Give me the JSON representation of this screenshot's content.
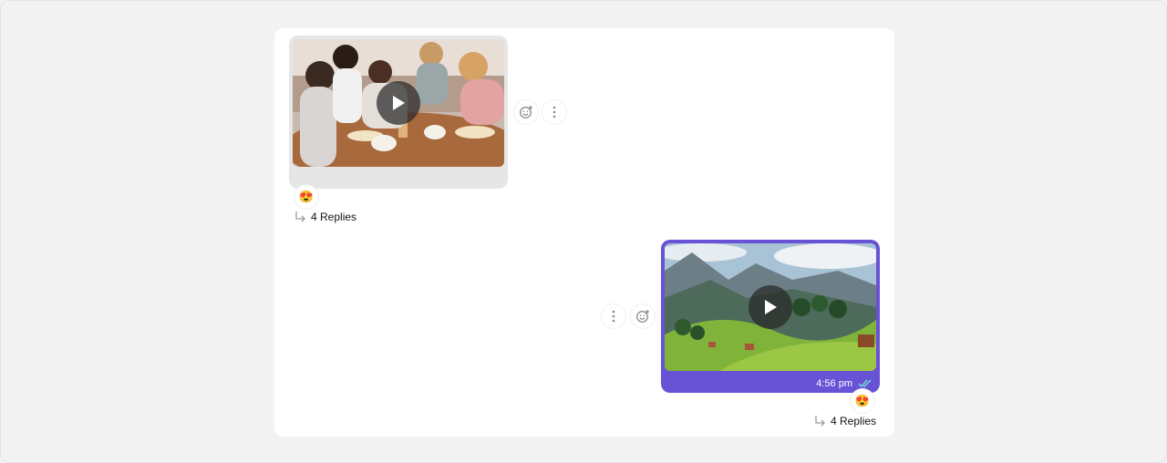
{
  "messages": [
    {
      "direction": "incoming",
      "type": "video",
      "thumbnail": "friends-playing-jenga-game",
      "play_icon": "play-icon",
      "reaction": "😍",
      "replies_label": "4 Replies"
    },
    {
      "direction": "outgoing",
      "type": "video",
      "thumbnail": "mountain-valley-landscape",
      "play_icon": "play-icon",
      "time": "4:56 pm",
      "status_icon": "double-check-icon",
      "reaction": "😍",
      "replies_label": "4 Replies"
    }
  ],
  "colors": {
    "outgoing_bubble": "#6852d6",
    "incoming_bubble": "#e6e6e6",
    "panel": "#ffffff",
    "background": "#f3f3f3"
  },
  "icons": [
    "add-reaction-icon",
    "more-options-icon",
    "reply-arrow-icon"
  ]
}
